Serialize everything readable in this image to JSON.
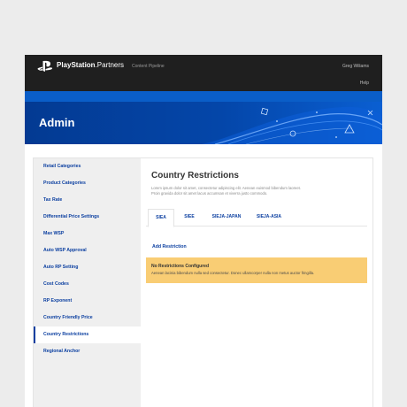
{
  "header": {
    "brand_bold": "PlayStation",
    "brand_rest": ".Partners",
    "subbrand": "Content Pipeline",
    "user": "Greg Wiliams",
    "help": "Help",
    "logo_icon": "playstation-logo-icon"
  },
  "hero": {
    "title": "Admin"
  },
  "sidebar": {
    "items": [
      {
        "label": "Retail Categories"
      },
      {
        "label": "Product Categories"
      },
      {
        "label": "Tax Rate"
      },
      {
        "label": "Differential Price Settings"
      },
      {
        "label": "Max WSP"
      },
      {
        "label": "Auto WSP Approval"
      },
      {
        "label": "Auto RP Setting"
      },
      {
        "label": "Cost Codes"
      },
      {
        "label": "RP Exponent"
      },
      {
        "label": "Country Friendly Price"
      },
      {
        "label": "Country Restrictions"
      },
      {
        "label": "Regional Anchor"
      }
    ],
    "active_index": 10
  },
  "main": {
    "title": "Country Restrictions",
    "description_line1": "Lorem ipsum dolor sit amet, consectetur adipiscing elit. Aenean euismod bibendum laoreet.",
    "description_line2": "Proin gravida dolor sit amet lacus accumsan et viverra justo commodo.",
    "tabs": [
      {
        "label": "SIEA"
      },
      {
        "label": "SIEE"
      },
      {
        "label": "SIEJA-JAPAN"
      },
      {
        "label": "SIEJA-ASIA"
      }
    ],
    "active_tab": 0,
    "add_button": "Add Restriction",
    "alert": {
      "title": "No Restrictions Configured",
      "text": "Aenean lacinia bibendum nulla sed consectetur. Donec ullamcorper nulla non metus auctor fringilla."
    }
  },
  "colors": {
    "accent": "#0b3fa0",
    "topbar": "#1f1f1f",
    "hero_blue": "#0446a9",
    "alert_bg": "#f9cd74"
  }
}
